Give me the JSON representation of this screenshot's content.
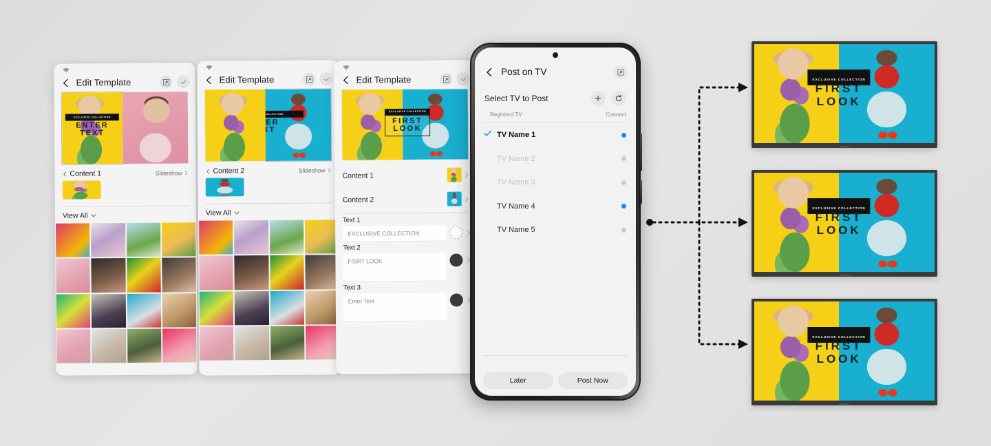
{
  "background_color": "#dedede",
  "accent": {
    "blue": "#1a8cf0",
    "yellow": "#f5d016",
    "cyan": "#18afd0",
    "dark": "#111111"
  },
  "cards": [
    {
      "id": "card-1",
      "title": "Edit Template",
      "icons": {
        "back": "chevron-left-icon",
        "expand": "expand-icon",
        "confirm": "check-icon",
        "wifi": "wifi-icon"
      },
      "content_row": {
        "label": "Content 1",
        "action": "Slideshow"
      },
      "view_all": "View All",
      "template_text": {
        "banner": "EXCLUSIVE COLLECTION",
        "line1": "ENTER",
        "line2": "TEXT"
      }
    },
    {
      "id": "card-2",
      "title": "Edit Template",
      "icons": {
        "back": "chevron-left-icon",
        "expand": "expand-icon",
        "confirm": "check-icon",
        "wifi": "wifi-icon"
      },
      "content_row": {
        "label": "Content 2",
        "action": "Slideshow"
      },
      "view_all": "View All",
      "template_text": {
        "banner": "EXCLUSIVE COLLECTION",
        "line1": "ENTER",
        "line2": "TEXT"
      }
    },
    {
      "id": "card-3",
      "title": "Edit Template",
      "icons": {
        "back": "chevron-left-icon",
        "expand": "expand-icon",
        "confirm": "check-icon",
        "wifi": "wifi-icon"
      },
      "content_rows": [
        {
          "label": "Content 1"
        },
        {
          "label": "Content 2"
        }
      ],
      "text_fields": [
        {
          "label": "Text 1",
          "value": "EXCLUSIVE COLLECTION",
          "swatch": "white"
        },
        {
          "label": "Text 2",
          "value": "FISRT LOOK",
          "swatch": "dark"
        },
        {
          "label": "Text 3",
          "value": "Enter Text",
          "swatch": "dark"
        }
      ],
      "template_text": {
        "banner": "EXCLUSIVE COLLECTION",
        "line1": "FIRST",
        "line2": "LOOK"
      }
    }
  ],
  "phone": {
    "header": {
      "title": "Post on TV",
      "back_icon": "chevron-left-icon",
      "expand_icon": "expand-icon"
    },
    "section": {
      "title": "Select TV to Post",
      "add_icon": "plus-icon",
      "refresh_icon": "refresh-icon",
      "col_left": "Registerd TV",
      "col_right": "Connect"
    },
    "tv_list": [
      {
        "name": "TV Name 1",
        "selected": true,
        "state": "on",
        "status_color": "#1a8cf0"
      },
      {
        "name": "TV Name 2",
        "selected": false,
        "state": "off",
        "status_color": "#c9c9c9"
      },
      {
        "name": "TV Name 3",
        "selected": false,
        "state": "off",
        "status_color": "#c9c9c9"
      },
      {
        "name": "TV Name 4",
        "selected": false,
        "state": "idle",
        "status_color": "#1a8cf0"
      },
      {
        "name": "TV Name 5",
        "selected": false,
        "state": "idle",
        "status_color": "#c9c9c9"
      }
    ],
    "footer": {
      "later": "Later",
      "post_now": "Post Now"
    }
  },
  "tv_displays": [
    {
      "id": "tv-top",
      "banner": "EXCLUSIVE COLLECTION",
      "line1": "FIRST",
      "line2": "LOOK"
    },
    {
      "id": "tv-middle",
      "banner": "EXCLUSIVE COLLECTION",
      "line1": "FIRST",
      "line2": "LOOK"
    },
    {
      "id": "tv-bottom",
      "banner": "EXCLUSIVE COLLECTION",
      "line1": "FIRST",
      "line2": "LOOK"
    }
  ],
  "flow": {
    "description": "phone posts content to three TVs",
    "arrow_style": "dotted"
  }
}
